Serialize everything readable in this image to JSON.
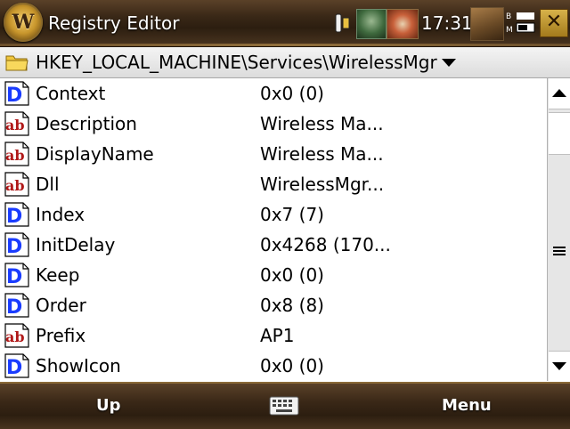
{
  "title_bar": {
    "app_title": "Registry Editor",
    "clock": "17:31",
    "close_glyph": "✕",
    "logo_letter": "W",
    "logo_icon": "world-of-warcraft-logo-icon"
  },
  "path_bar": {
    "path": "HKEY_LOCAL_MACHINE\\Services\\WirelessMgr",
    "folder_icon": "folder-icon"
  },
  "values": [
    {
      "type": "dword",
      "name": "Context",
      "value": "0x0 (0)"
    },
    {
      "type": "string",
      "name": "Description",
      "value": "Wireless Ma..."
    },
    {
      "type": "string",
      "name": "DisplayName",
      "value": "Wireless Ma..."
    },
    {
      "type": "string",
      "name": "Dll",
      "value": "WirelessMgr..."
    },
    {
      "type": "dword",
      "name": "Index",
      "value": "0x7 (7)"
    },
    {
      "type": "dword",
      "name": "InitDelay",
      "value": "0x4268 (170..."
    },
    {
      "type": "dword",
      "name": "Keep",
      "value": "0x0 (0)"
    },
    {
      "type": "dword",
      "name": "Order",
      "value": "0x8 (8)"
    },
    {
      "type": "string",
      "name": "Prefix",
      "value": "AP1"
    },
    {
      "type": "dword",
      "name": "ShowIcon",
      "value": "0x0 (0)"
    }
  ],
  "softkeys": {
    "left": "Up",
    "right": "Menu",
    "center_icon": "keyboard-icon"
  },
  "colors": {
    "dword_icon_blue": "#1a3cff",
    "string_icon_red": "#b01818",
    "bar_brown": "#3a2817"
  }
}
